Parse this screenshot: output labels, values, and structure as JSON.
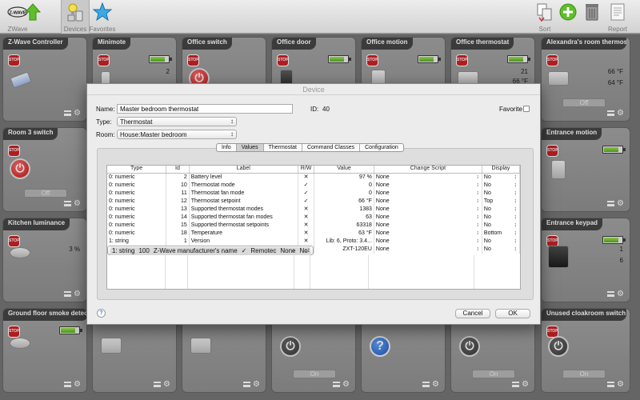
{
  "toolbar": {
    "zwave_label": "ZWave",
    "zwave_logo": "Z-WAVE",
    "devices_label": "Devices",
    "favorites_label": "Favorites",
    "sort_label": "Sort",
    "report_label": "Report"
  },
  "tiles": [
    {
      "name": "Z-Wave Controller",
      "stop": "STOP",
      "icon": "usb-stick-icon"
    },
    {
      "name": "Minimote",
      "stop": "STOP",
      "value": "2",
      "battery_level": 0.85
    },
    {
      "name": "Office switch",
      "stop": "STOP",
      "icon": "power-icon"
    },
    {
      "name": "Office door",
      "stop": "STOP",
      "battery_level": 0.85
    },
    {
      "name": "Office motion",
      "stop": "STOP",
      "battery_level": 0.85
    },
    {
      "name": "Office thermostat",
      "stop": "STOP",
      "value1": "21",
      "value2": "66 °F",
      "battery_level": 0.85
    },
    {
      "name": "Alexandra's room thermostat",
      "stop": "STOP",
      "value1": "66 °F",
      "value2": "64 °F",
      "button": "Off"
    },
    {
      "name": "Room 3 switch",
      "stop": "STOP",
      "button": "Off"
    },
    {
      "name": "Entrance motion",
      "stop": "STOP",
      "battery_level": 0.85
    },
    {
      "name": "Kitchen luminance",
      "stop": "STOP",
      "value": "3 %"
    },
    {
      "name": "Entrance keypad",
      "stop": "STOP",
      "value1": "1",
      "value2": "6",
      "battery_level": 0.85
    },
    {
      "name": "Ground floor smoke detector",
      "stop": "STOP",
      "battery_level": 0.85
    },
    {
      "name": "Unused cloakroom switch",
      "stop": "STOP",
      "button": "On"
    },
    {
      "button": "On"
    },
    {
      "button": "On"
    }
  ],
  "dialog": {
    "title": "Device",
    "name_label": "Name:",
    "name_value": "Master bedroom thermostat",
    "id_label": "ID:",
    "id_value": "40",
    "favorite_label": "Favorite",
    "type_label": "Type:",
    "type_value": "Thermostat",
    "room_label": "Room:",
    "room_value": "House:Master bedroom",
    "tabs": [
      "Info",
      "Values",
      "Thermostat",
      "Command Classes",
      "Configuration"
    ],
    "active_tab": "Values",
    "columns": [
      "Type",
      "Id",
      "Label",
      "R/W",
      "Value",
      "Change Script",
      "Display"
    ],
    "rows": [
      {
        "type": "0: numeric",
        "id": "2",
        "label": "Battery level",
        "rw": "✕",
        "value": "97 %",
        "script": "None",
        "display": "No"
      },
      {
        "type": "0: numeric",
        "id": "10",
        "label": "Thermostat mode",
        "rw": "✓",
        "value": "0",
        "script": "None",
        "display": "No"
      },
      {
        "type": "0: numeric",
        "id": "11",
        "label": "Thermostat fan mode",
        "rw": "✓",
        "value": "0",
        "script": "None",
        "display": "No"
      },
      {
        "type": "0: numeric",
        "id": "12",
        "label": "Thermostat setpoint",
        "rw": "✓",
        "value": "66 °F",
        "script": "None",
        "display": "Top"
      },
      {
        "type": "0: numeric",
        "id": "13",
        "label": "Supported thermostat modes",
        "rw": "✕",
        "value": "1383",
        "script": "None",
        "display": "No"
      },
      {
        "type": "0: numeric",
        "id": "14",
        "label": "Supported thermostat fan modes",
        "rw": "✕",
        "value": "63",
        "script": "None",
        "display": "No"
      },
      {
        "type": "0: numeric",
        "id": "15",
        "label": "Supported thermostat setpoints",
        "rw": "✕",
        "value": "63318",
        "script": "None",
        "display": "No"
      },
      {
        "type": "0: numeric",
        "id": "18",
        "label": "Temperature",
        "rw": "✕",
        "value": "63 °F",
        "script": "None",
        "display": "Bottom"
      },
      {
        "type": "1: string",
        "id": "1",
        "label": "Version",
        "rw": "✕",
        "value": "Lib: 6, Proto: 3.4...",
        "script": "None",
        "display": "No"
      },
      {
        "type": "1: string",
        "id": "100",
        "label": "Z-Wave manufacturer's name",
        "rw": "✓",
        "value": "Remotec",
        "script": "None",
        "display": "No"
      },
      {
        "type": "1: string",
        "id": "101",
        "label": "Z-Wave product name",
        "rw": "✓",
        "value": "ZXT-120EU",
        "script": "None",
        "display": "No"
      }
    ],
    "selected_row": 9,
    "cancel_label": "Cancel",
    "ok_label": "OK",
    "help_label": "?"
  },
  "colors": {
    "accent_green": "#4ea81a",
    "stop_red": "#c8171a",
    "tile_header": "#3b3b3b"
  }
}
